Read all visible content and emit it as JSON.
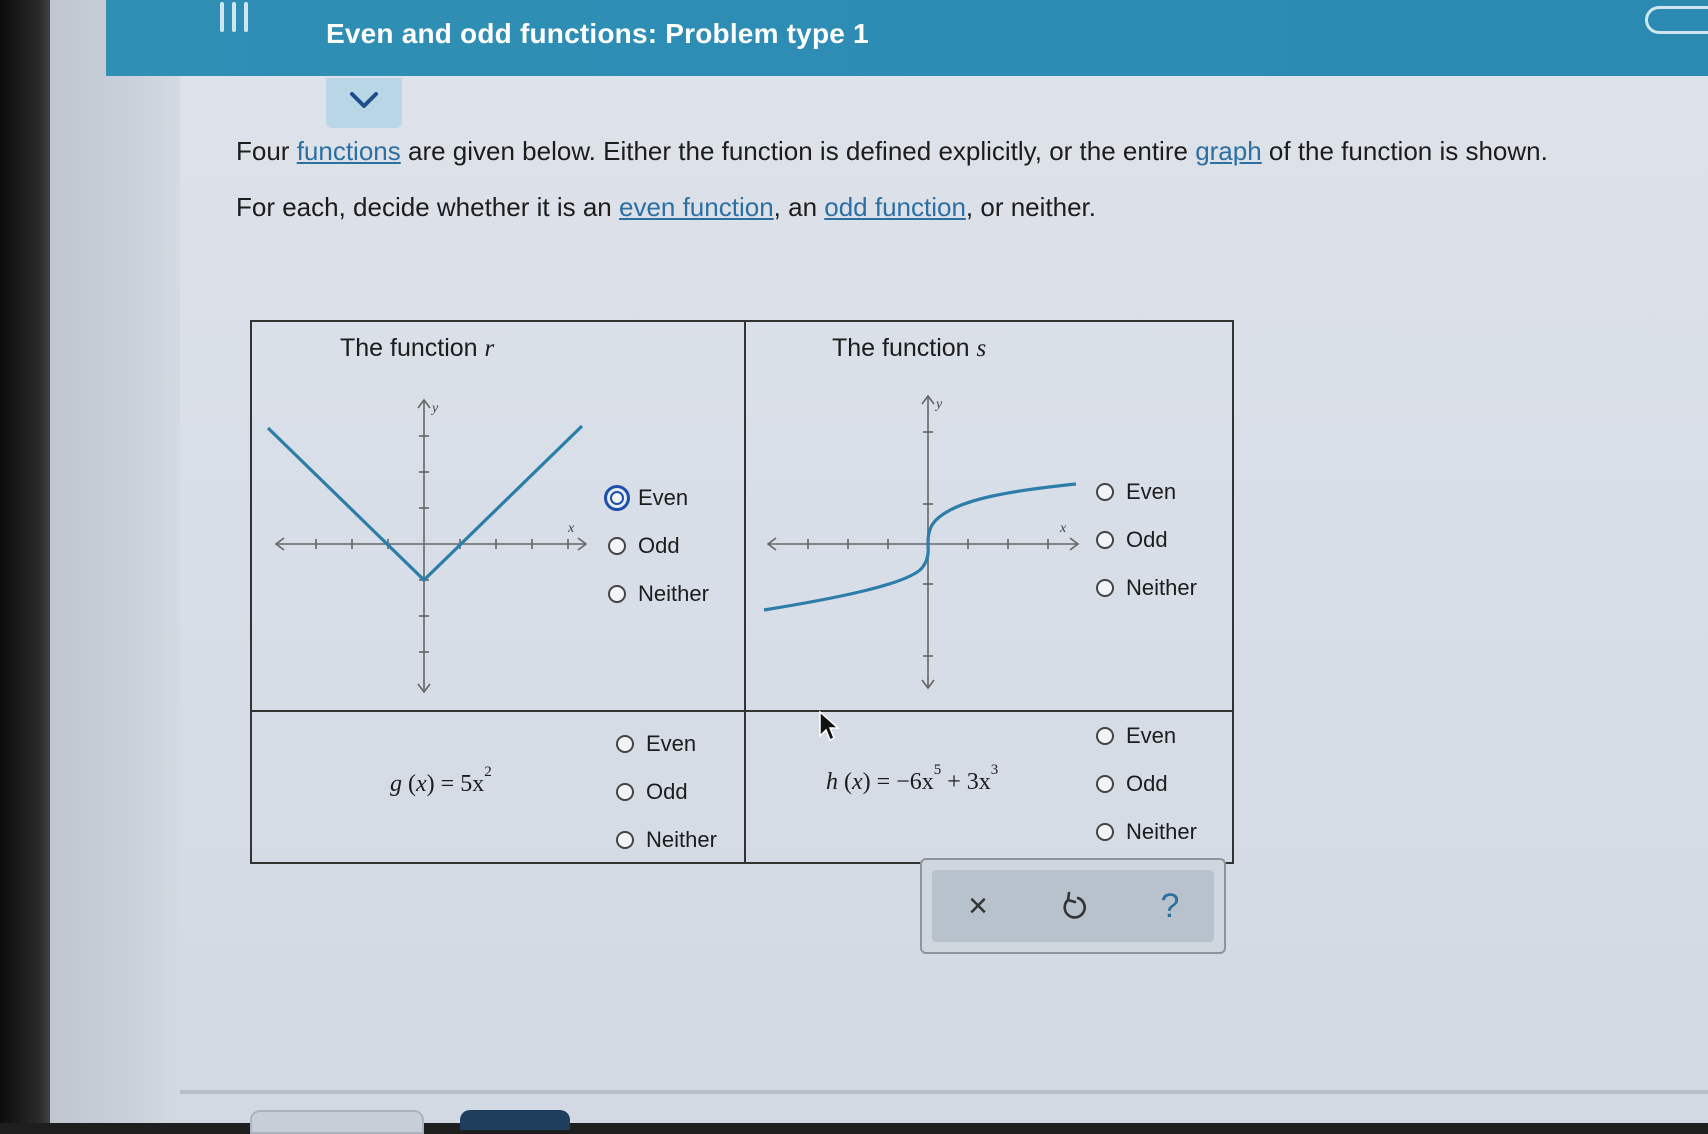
{
  "header": {
    "title": "Even and odd functions: Problem type 1"
  },
  "intro": {
    "line1_before": "Four ",
    "link_functions": "functions",
    "line1_middle": " are given below. Either the function is defined explicitly, or the entire ",
    "link_graph": "graph",
    "line1_after": " of the function is shown.",
    "line2_before": "For each, decide whether it is an ",
    "link_even": "even function",
    "line2_middle": ", an ",
    "link_odd": "odd function",
    "line2_after": ", or neither."
  },
  "cells": {
    "r": {
      "title": "The function ",
      "name": "r",
      "options": [
        "Even",
        "Odd",
        "Neither"
      ],
      "focused_option": "Even"
    },
    "s": {
      "title": "The function ",
      "name": "s",
      "options": [
        "Even",
        "Odd",
        "Neither"
      ]
    },
    "g": {
      "formula_lhs": "g",
      "formula_arg": "x",
      "formula_rhs": "= 5x",
      "formula_exp": "2",
      "options": [
        "Even",
        "Odd",
        "Neither"
      ]
    },
    "h": {
      "formula_lhs": "h",
      "formula_arg": "x",
      "formula_rhs1": "= −6x",
      "formula_exp1": "5",
      "formula_rhs2": "+ 3x",
      "formula_exp2": "3",
      "options": [
        "Even",
        "Odd",
        "Neither"
      ]
    }
  },
  "axes": {
    "x_label": "x",
    "y_label": "y"
  },
  "toolbar": {
    "clear_symbol": "×",
    "help_symbol": "?"
  },
  "colors": {
    "header": "#2f8fb5",
    "curve": "#2c7da8",
    "link": "#2b6fa3",
    "focus": "#1f4fa8"
  }
}
